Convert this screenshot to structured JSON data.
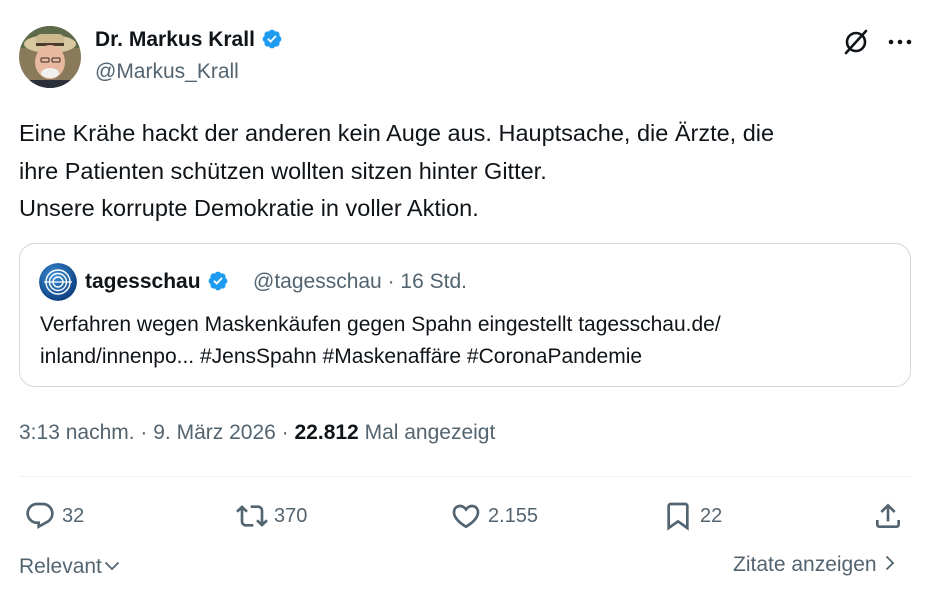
{
  "author": {
    "name": "Dr. Markus Krall",
    "handle": "@Markus_Krall"
  },
  "tweet": {
    "text": "Eine Krähe hackt der anderen kein Auge aus. Hauptsache, die Ärzte, die\nihre Patienten schützen wollten sitzen hinter Gitter.\nUnsere korrupte Demokratie in voller Aktion."
  },
  "quote": {
    "name": "tagesschau",
    "handle": "@tagesschau",
    "separator": " · ",
    "time": "16 Std.",
    "text": "Verfahren wegen Maskenkäufen gegen Spahn eingestellt tagesschau.de/\ninland/innenpo... #JensSpahn #Maskenaffäre #CoronaPandemie"
  },
  "meta": {
    "time": "3:13 nachm.",
    "separator": " · ",
    "date": "9. März 2026",
    "views_count": "22.812",
    "views_label": "Mal angezeigt"
  },
  "actions": {
    "replies": "32",
    "reposts": "370",
    "likes": "2.155",
    "bookmarks": "22"
  },
  "footer": {
    "relevant": "Relevant",
    "quotes": "Zitate anzeigen"
  },
  "colors": {
    "verified": "#1d9bf0",
    "secondary_text": "#536471",
    "primary_text": "#0f1419",
    "border": "#cfd9de"
  },
  "icons": [
    "verified-badge-icon",
    "grok-icon",
    "more-icon",
    "reply-icon",
    "repost-icon",
    "like-icon",
    "bookmark-icon",
    "share-icon",
    "chevron-down-icon",
    "chevron-right-icon"
  ]
}
